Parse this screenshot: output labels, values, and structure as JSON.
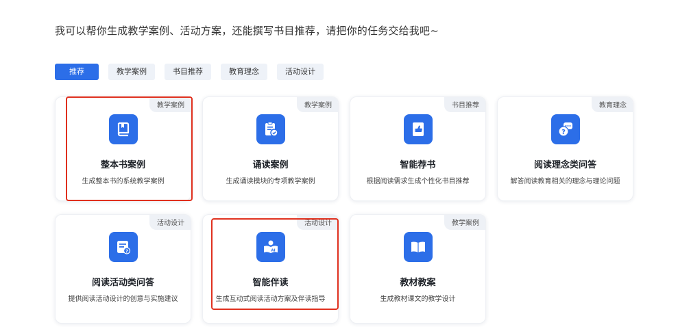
{
  "intro": "我可以帮你生成教学案例、活动方案，还能撰写书目推荐，请把你的任务交给我吧~",
  "tabs": [
    {
      "label": "推荐"
    },
    {
      "label": "教学案例"
    },
    {
      "label": "书目推荐"
    },
    {
      "label": "教育理念"
    },
    {
      "label": "活动设计"
    }
  ],
  "cards": [
    {
      "tag": "教学案例",
      "title": "整本书案例",
      "desc": "生成整本书的系统教学案例",
      "icon": "book-icon"
    },
    {
      "tag": "教学案例",
      "title": "诵读案例",
      "desc": "生成诵读模块的专项教学案例",
      "icon": "clipboard-check-icon"
    },
    {
      "tag": "书目推荐",
      "title": "智能荐书",
      "desc": "根据阅读需求生成个性化书目推荐",
      "icon": "thumbs-up-book-icon"
    },
    {
      "tag": "教育理念",
      "title": "阅读理念类问答",
      "desc": "解答阅读教育相关的理念与理论问题",
      "icon": "chat-question-icon"
    },
    {
      "tag": "活动设计",
      "title": "阅读活动类问答",
      "desc": "提供阅读活动设计的创意与实施建议",
      "icon": "document-question-icon"
    },
    {
      "tag": "活动设计",
      "title": "智能伴读",
      "desc": "生成互动式阅读活动方案及伴读指导",
      "icon": "ai-reading-icon"
    },
    {
      "tag": "教学案例",
      "title": "教材教案",
      "desc": "生成教材课文的教学设计",
      "icon": "open-book-icon"
    }
  ],
  "colors": {
    "accent": "#2c6ee8",
    "highlight": "#e0301e",
    "tag_bg": "#eef1f6"
  }
}
